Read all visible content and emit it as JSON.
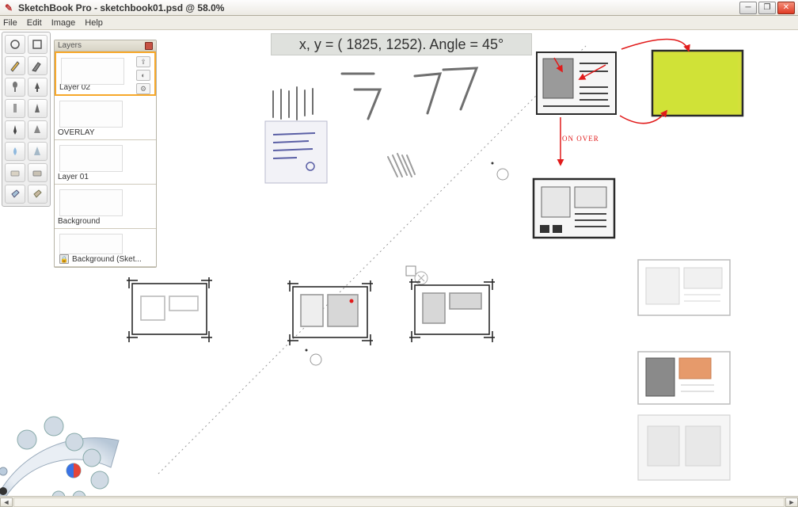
{
  "window": {
    "title": "SketchBook Pro - sketchbook01.psd @ 58.0%"
  },
  "menu": {
    "file": "File",
    "edit": "Edit",
    "image": "Image",
    "help": "Help"
  },
  "coord": {
    "text": "x, y = (  1825,   1252). Angle = 45°"
  },
  "layers": {
    "title": "Layers",
    "items": [
      {
        "name": "Layer 02"
      },
      {
        "name": "OVERLAY"
      },
      {
        "name": "Layer 01"
      },
      {
        "name": "Background"
      },
      {
        "name": "Background (Sket..."
      }
    ]
  },
  "annotation": {
    "onover": "ON OVER"
  },
  "colors": {
    "highlight": "#d4e03a",
    "ink_red": "#e11b1b",
    "ink_gray": "#6f6f6f",
    "ink_blue": "#5a5fa5"
  }
}
